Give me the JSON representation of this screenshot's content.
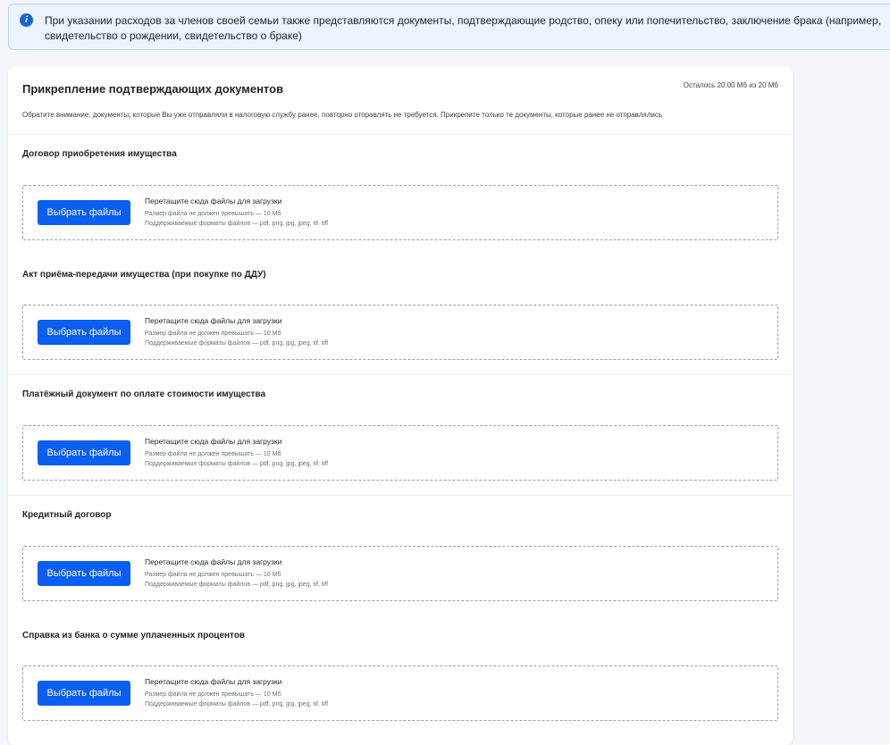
{
  "banner": {
    "icon": "info-icon",
    "text": "При указании расходов за членов своей семьи также представляются документы, подтверждающие родство, опеку или попечительство, заключение брака (например, свидетельство о рождении, свидетельство о браке)"
  },
  "attachments": {
    "title": "Прикрепление подтверждающих документов",
    "quota": "Осталось 20.00 Мб из 20 Мб",
    "notice": "Обратите внимание, документы, которые Вы уже отправляли в налоговую службу ранее, повторно отправлять не требуется. Прикрепите только те документы, которые ранее не отправлялись",
    "sections": [
      {
        "title": "Договор приобретения имущества",
        "button": "Выбрать файлы",
        "drop_text": "Перетащите сюда файлы для загрузки",
        "size_limit": "Размер файла не должен превышать — 10 Мб",
        "formats": "Поддерживаемые форматы файлов — pdf, png, jpg, jpeg, tif, tiff"
      },
      {
        "title": "Акт приёма-передачи имущества (при покупке по ДДУ)",
        "button": "Выбрать файлы",
        "drop_text": "Перетащите сюда файлы для загрузки",
        "size_limit": "Размер файла не должен превышать — 10 Мб",
        "formats": "Поддерживаемые форматы файлов — pdf, png, jpg, jpeg, tif, tiff"
      },
      {
        "title": "Платёжный документ по оплате стоимости имущества",
        "button": "Выбрать файлы",
        "drop_text": "Перетащите сюда файлы для загрузки",
        "size_limit": "Размер файла не должен превышать — 10 Мб",
        "formats": "Поддерживаемые форматы файлов — pdf, png, jpg, jpeg, tif, tiff"
      },
      {
        "title": "Кредитный договор",
        "button": "Выбрать файлы",
        "drop_text": "Перетащите сюда файлы для загрузки",
        "size_limit": "Размер файла не должен превышать — 10 Мб",
        "formats": "Поддерживаемые форматы файлов — pdf, png, jpg, jpeg, tif, tiff"
      },
      {
        "title": "Справка из банка о сумме уплаченных процентов",
        "button": "Выбрать файлы",
        "drop_text": "Перетащите сюда файлы для загрузки",
        "size_limit": "Размер файла не должен превышать — 10 Мб",
        "formats": "Поддерживаемые форматы файлов — pdf, png, jpg, jpeg, tif, tiff"
      }
    ]
  }
}
